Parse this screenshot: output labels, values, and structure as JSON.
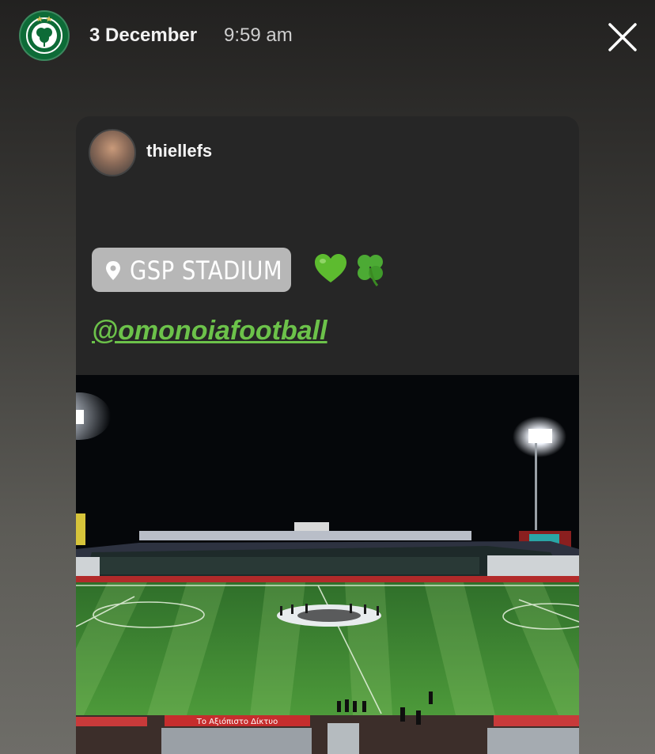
{
  "header": {
    "date": "3 December",
    "time": "9:59 am",
    "club_avatar_icon": "omonoia-crest-icon",
    "close_icon": "close-icon"
  },
  "post": {
    "username": "thiellefs",
    "location": "GSP STADIUM",
    "emojis": [
      "green-heart",
      "shamrock"
    ],
    "mention": "@omonoiafootball"
  },
  "photo": {
    "description_icon": "stadium-night-photo",
    "banner_text": "Το Αξιόπιστο Δίκτυο"
  },
  "colors": {
    "mention_green": "#6cc24a",
    "sticker_gray": "#b7b7b7",
    "club_green": "#0d6b37",
    "pitch_green": "#3f8a33"
  }
}
